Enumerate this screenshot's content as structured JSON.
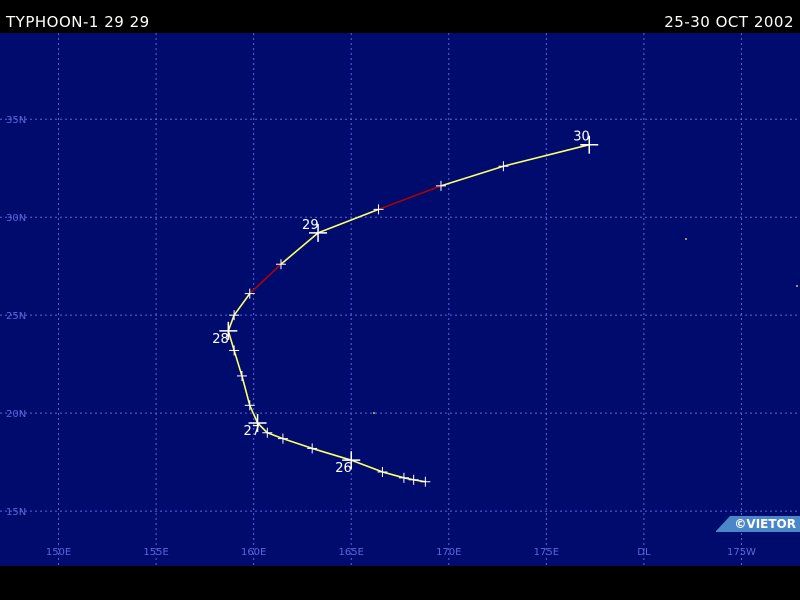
{
  "header": {
    "storm_title": "TYPHOON-1 29 29",
    "date_range": "25-30 OCT 2002"
  },
  "credit": "©VIETOR",
  "map": {
    "lon_labels": [
      "150E",
      "155E",
      "160E",
      "165E",
      "170E",
      "175E",
      "DL",
      "175W"
    ],
    "lat_labels": [
      "35N",
      "30N",
      "25N",
      "20N",
      "15N"
    ],
    "lon_range_deg_east": [
      147,
      188
    ],
    "lat_range_deg_north": [
      12.2,
      39.4
    ],
    "grid": true,
    "colors": {
      "ocean": "#000b6e",
      "grid": "#5a66d8",
      "track_typhoon": "#ffff66",
      "track_storm": "#b00000",
      "markers": "#ffffff"
    }
  },
  "track": [
    {
      "lon": 168.8,
      "lat": 16.5,
      "cat": "typhoon"
    },
    {
      "lon": 168.2,
      "lat": 16.6
    },
    {
      "lon": 167.7,
      "lat": 16.7
    },
    {
      "lon": 166.6,
      "lat": 17.0
    },
    {
      "lon": 165.0,
      "lat": 17.6,
      "day": "26"
    },
    {
      "lon": 163.0,
      "lat": 18.2
    },
    {
      "lon": 161.5,
      "lat": 18.7
    },
    {
      "lon": 160.7,
      "lat": 19.0
    },
    {
      "lon": 160.2,
      "lat": 19.5,
      "day": "27"
    },
    {
      "lon": 159.8,
      "lat": 20.4
    },
    {
      "lon": 159.4,
      "lat": 21.9
    },
    {
      "lon": 159.0,
      "lat": 23.2
    },
    {
      "lon": 158.7,
      "lat": 24.2,
      "day": "28"
    },
    {
      "lon": 159.0,
      "lat": 25.0
    },
    {
      "lon": 159.8,
      "lat": 26.1,
      "cat": "storm"
    },
    {
      "lon": 161.4,
      "lat": 27.6,
      "cat": "typhoon"
    },
    {
      "lon": 163.3,
      "lat": 29.2,
      "day": "29"
    },
    {
      "lon": 166.4,
      "lat": 30.4,
      "cat": "storm"
    },
    {
      "lon": 169.6,
      "lat": 31.6,
      "cat": "typhoon"
    },
    {
      "lon": 172.8,
      "lat": 32.6
    },
    {
      "lon": 177.2,
      "lat": 33.7,
      "day": "30"
    }
  ]
}
